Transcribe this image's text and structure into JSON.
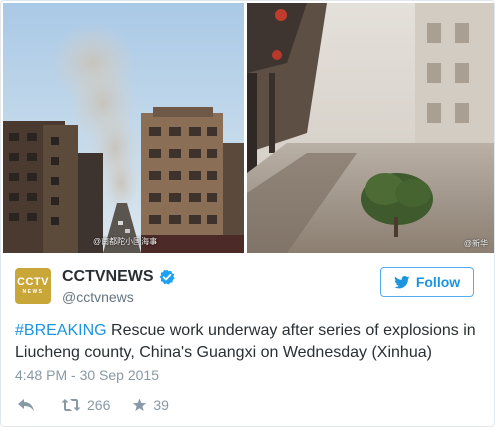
{
  "photos": {
    "left_watermark": "@南都陀小国海事",
    "right_watermark": "@新华"
  },
  "account": {
    "logo_line1": "CCTV",
    "logo_line2": "NEWS",
    "display_name": "CCTVNEWS",
    "handle": "@cctvnews",
    "verified": true
  },
  "follow_label": "Follow",
  "tweet": {
    "hashtag": "#BREAKING",
    "text": " Rescue work underway after series of explosions in Liucheng county, China's Guangxi on Wednesday (Xinhua)",
    "timestamp": "4:48 PM - 30 Sep 2015"
  },
  "stats": {
    "retweets": "266",
    "likes": "39"
  },
  "colors": {
    "link": "#1b95e0",
    "verified": "#1da1f2",
    "logo": "#c9a638",
    "muted": "#8899a6"
  }
}
